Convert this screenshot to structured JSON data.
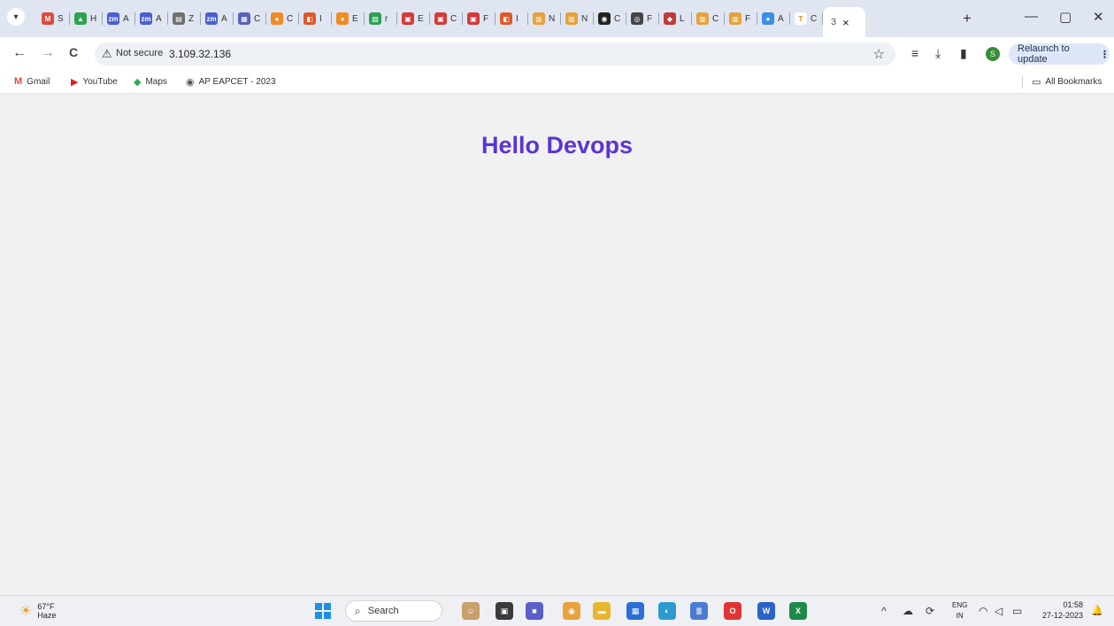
{
  "browser": {
    "tabs": [
      {
        "icon": "gmail-icon",
        "glyph": "M",
        "color": "#e04a3a",
        "title": "S"
      },
      {
        "icon": "drive-icon",
        "glyph": "▲",
        "color": "#2ea44f",
        "title": "H"
      },
      {
        "icon": "zoom-icon",
        "glyph": "zm",
        "color": "#4a5fd1",
        "title": "A"
      },
      {
        "icon": "zoom-icon",
        "glyph": "zm",
        "color": "#4a5fd1",
        "title": "A"
      },
      {
        "icon": "document-icon",
        "glyph": "▤",
        "color": "#6f6f6f",
        "title": "Z"
      },
      {
        "icon": "zoom-icon",
        "glyph": "zm",
        "color": "#4a5fd1",
        "title": "A"
      },
      {
        "icon": "form-icon",
        "glyph": "▦",
        "color": "#5a62b8",
        "title": "C"
      },
      {
        "icon": "aws-icon",
        "glyph": "●",
        "color": "#f08a24",
        "title": "C"
      },
      {
        "icon": "extension-icon",
        "glyph": "◧",
        "color": "#e0582a",
        "title": "I"
      },
      {
        "icon": "aws-icon",
        "glyph": "●",
        "color": "#f08a24",
        "title": "E"
      },
      {
        "icon": "sheet-icon",
        "glyph": "▧",
        "color": "#2f9e58",
        "title": "r"
      },
      {
        "icon": "doc-red-icon",
        "glyph": "▣",
        "color": "#d33a3a",
        "title": "E"
      },
      {
        "icon": "doc-red-icon",
        "glyph": "▣",
        "color": "#d33a3a",
        "title": "C"
      },
      {
        "icon": "doc-red-icon",
        "glyph": "▣",
        "color": "#d33a3a",
        "title": "F"
      },
      {
        "icon": "extension-icon",
        "glyph": "◧",
        "color": "#e0582a",
        "title": "I"
      },
      {
        "icon": "box-icon",
        "glyph": "▥",
        "color": "#e3a23b",
        "title": "N"
      },
      {
        "icon": "box-icon",
        "glyph": "▥",
        "color": "#e3a23b",
        "title": "N"
      },
      {
        "icon": "github-icon",
        "glyph": "◉",
        "color": "#222222",
        "title": "C"
      },
      {
        "icon": "circle-icon",
        "glyph": "◎",
        "color": "#444444",
        "title": "F"
      },
      {
        "icon": "globe-icon",
        "glyph": "◆",
        "color": "#c03a3a",
        "title": "L"
      },
      {
        "icon": "box-icon",
        "glyph": "▥",
        "color": "#e3a23b",
        "title": "C"
      },
      {
        "icon": "box-icon",
        "glyph": "▥",
        "color": "#e3a23b",
        "title": "F"
      },
      {
        "icon": "gemini-icon",
        "glyph": "●",
        "color": "#3b8ee8",
        "title": "A"
      },
      {
        "icon": "text-icon",
        "glyph": "T",
        "color": "#ffffff",
        "glyphColor": "#e08a24",
        "title": "C"
      }
    ],
    "active_tab": {
      "title": "3",
      "close": "×"
    },
    "new_tab_label": "+",
    "window": {
      "minimize": "—",
      "maximize": "▢",
      "close": "✕"
    }
  },
  "toolbar": {
    "back": "←",
    "forward": "→",
    "reload": "C",
    "security_warning_icon": "⚠",
    "security_label": "Not secure",
    "url": "3.109.32.136",
    "bookmark_star": "☆",
    "reading_list": "≡",
    "download": "⤓",
    "sidepanel": "▮",
    "profile_initial": "S",
    "relaunch_label": "Relaunch to update",
    "menu_dots": "⋮"
  },
  "bookmarks": {
    "items": [
      {
        "label": "Gmail",
        "icon": "M",
        "color": "#e04a3a"
      },
      {
        "label": "YouTube",
        "icon": "▶",
        "color": "#e02020"
      },
      {
        "label": "Maps",
        "icon": "◆",
        "color": "#34a853"
      },
      {
        "label": "AP EAPCET - 2023",
        "icon": "◉",
        "color": "#555555"
      }
    ],
    "all_bookmarks_icon": "▭",
    "all_bookmarks": "All Bookmarks"
  },
  "page": {
    "heading": "Hello Devops"
  },
  "taskbar": {
    "weather_temp": "67°F",
    "weather_desc": "Haze",
    "search_placeholder": "Search",
    "search_icon": "⌕",
    "lang_top": "ENG",
    "lang_bottom": "IN",
    "time": "01:58",
    "date": "27-12-2023",
    "tray_chevron": "^",
    "apps": [
      {
        "name": "people-app-icon",
        "glyph": "☺",
        "color": "#c7a06b"
      },
      {
        "name": "taskview-icon",
        "glyph": "▣",
        "color": "#3b3b3b"
      },
      {
        "name": "meet-icon",
        "glyph": "■",
        "color": "#5b5fc7"
      },
      {
        "name": "chrome-icon",
        "glyph": "◉",
        "color": "#e8a33d"
      },
      {
        "name": "explorer-icon",
        "glyph": "▬",
        "color": "#e8b52e"
      },
      {
        "name": "store-icon",
        "glyph": "▦",
        "color": "#2a6fd6"
      },
      {
        "name": "edge-icon",
        "glyph": "◐",
        "color": "#2c9ad1"
      },
      {
        "name": "notepad-icon",
        "glyph": "≣",
        "color": "#4a7bd1"
      },
      {
        "name": "opera-icon",
        "glyph": "O",
        "color": "#e03434"
      },
      {
        "name": "word-icon",
        "glyph": "W",
        "color": "#2b63c6"
      },
      {
        "name": "excel-icon",
        "glyph": "X",
        "color": "#1e8a4a"
      }
    ]
  }
}
